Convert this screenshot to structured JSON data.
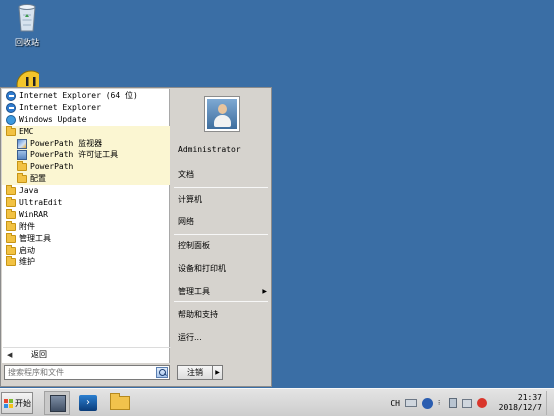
{
  "desktop": {
    "background_color": "#3a6ea5",
    "icons": [
      {
        "name": "recycle-bin",
        "label": "回收站"
      },
      {
        "name": "norton-ghost",
        "label": ""
      }
    ]
  },
  "start_menu": {
    "programs": [
      {
        "label": "Internet Explorer (64 位)",
        "icon": "ie-icon",
        "indent": 0,
        "highlight": false
      },
      {
        "label": "Internet Explorer",
        "icon": "ie-icon",
        "indent": 0,
        "highlight": false
      },
      {
        "label": "Windows Update",
        "icon": "windows-update-icon",
        "indent": 0,
        "highlight": false
      },
      {
        "label": "EMC",
        "icon": "folder-icon",
        "indent": 0,
        "highlight": true
      },
      {
        "label": "PowerPath 监视器",
        "icon": "powerpath-monitor-icon",
        "indent": 1,
        "highlight": true
      },
      {
        "label": "PowerPath 许可证工具",
        "icon": "license-tool-icon",
        "indent": 1,
        "highlight": true
      },
      {
        "label": "PowerPath",
        "icon": "folder-icon",
        "indent": 1,
        "highlight": true
      },
      {
        "label": "配置",
        "icon": "folder-icon",
        "indent": 1,
        "highlight": true
      },
      {
        "label": "Java",
        "icon": "folder-icon",
        "indent": 0,
        "highlight": false
      },
      {
        "label": "UltraEdit",
        "icon": "folder-icon",
        "indent": 0,
        "highlight": false
      },
      {
        "label": "WinRAR",
        "icon": "folder-icon",
        "indent": 0,
        "highlight": false
      },
      {
        "label": "附件",
        "icon": "folder-icon",
        "indent": 0,
        "highlight": false
      },
      {
        "label": "管理工具",
        "icon": "folder-icon",
        "indent": 0,
        "highlight": false
      },
      {
        "label": "启动",
        "icon": "folder-icon",
        "indent": 0,
        "highlight": false
      },
      {
        "label": "维护",
        "icon": "folder-icon",
        "indent": 0,
        "highlight": false
      }
    ],
    "back_label": "返回",
    "search_placeholder": "搜索程序和文件",
    "right_items": [
      {
        "label": "Administrator",
        "mono": true,
        "submenu": false
      },
      {
        "label": "文档",
        "mono": false,
        "submenu": false
      },
      {
        "label": "计算机",
        "mono": false,
        "submenu": false
      },
      {
        "label": "网络",
        "mono": false,
        "submenu": false
      },
      {
        "label": "控制面板",
        "mono": false,
        "submenu": false
      },
      {
        "label": "设备和打印机",
        "mono": false,
        "submenu": false
      },
      {
        "label": "管理工具",
        "mono": false,
        "submenu": true
      },
      {
        "label": "帮助和支持",
        "mono": false,
        "submenu": false
      },
      {
        "label": "运行...",
        "mono": false,
        "submenu": false
      }
    ],
    "shutdown_label": "注销",
    "highlight_color": "#fbf6d2"
  },
  "taskbar": {
    "start_label": "开始",
    "apps": [
      {
        "name": "server-manager",
        "pressed": true
      },
      {
        "name": "powershell",
        "pressed": false
      },
      {
        "name": "windows-explorer",
        "pressed": false
      }
    ],
    "language": "CH",
    "time": "21:37",
    "date": "2018/12/7"
  }
}
